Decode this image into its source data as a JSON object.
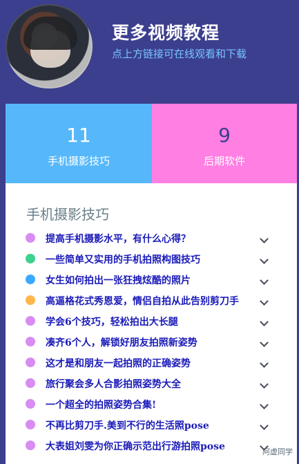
{
  "header": {
    "title": "更多视频教程",
    "subtitle": "点上方链接可在线观看和下载",
    "avatar_icon": "anime-avatar-icon"
  },
  "stats": {
    "left": {
      "number": "11",
      "label": "手机摄影技巧",
      "bg": "#56b8fb"
    },
    "right": {
      "number": "9",
      "label": "后期软件",
      "bg": "#ff7fe3"
    }
  },
  "panel": {
    "section_title": "手机摄影技巧",
    "items": [
      {
        "label": "提高手机摄影水平，有什么心得？",
        "dot": "#d88cf2"
      },
      {
        "label": "一些简单又实用的手机拍照构图技巧",
        "dot": "#3fd18f"
      },
      {
        "label": "女生如何拍出一张狂拽炫酷的照片",
        "dot": "#3aa9ff"
      },
      {
        "label": "高逼格花式秀恩爱，情侣自拍从此告别剪刀手",
        "dot": "#ffb64a"
      },
      {
        "label": "学会6个技巧，轻松拍出大长腿",
        "dot": "#d88cf2"
      },
      {
        "label": "凑齐6个人，解锁好朋友拍照新姿势",
        "dot": "#d88cf2"
      },
      {
        "label": "这才是和朋友一起拍照的正确姿势",
        "dot": "#d88cf2"
      },
      {
        "label": "旅行聚会多人合影拍照姿势大全",
        "dot": "#d88cf2"
      },
      {
        "label": "一个超全的拍照姿势合集!",
        "dot": "#d88cf2"
      },
      {
        "label": "不再比剪刀手.美到不行的生活照pose",
        "dot": "#d88cf2"
      },
      {
        "label": "大表姐刘雯为你正确示范出行游拍照pose",
        "dot": "#d88cf2"
      }
    ],
    "watermark": "阿虚同学"
  }
}
